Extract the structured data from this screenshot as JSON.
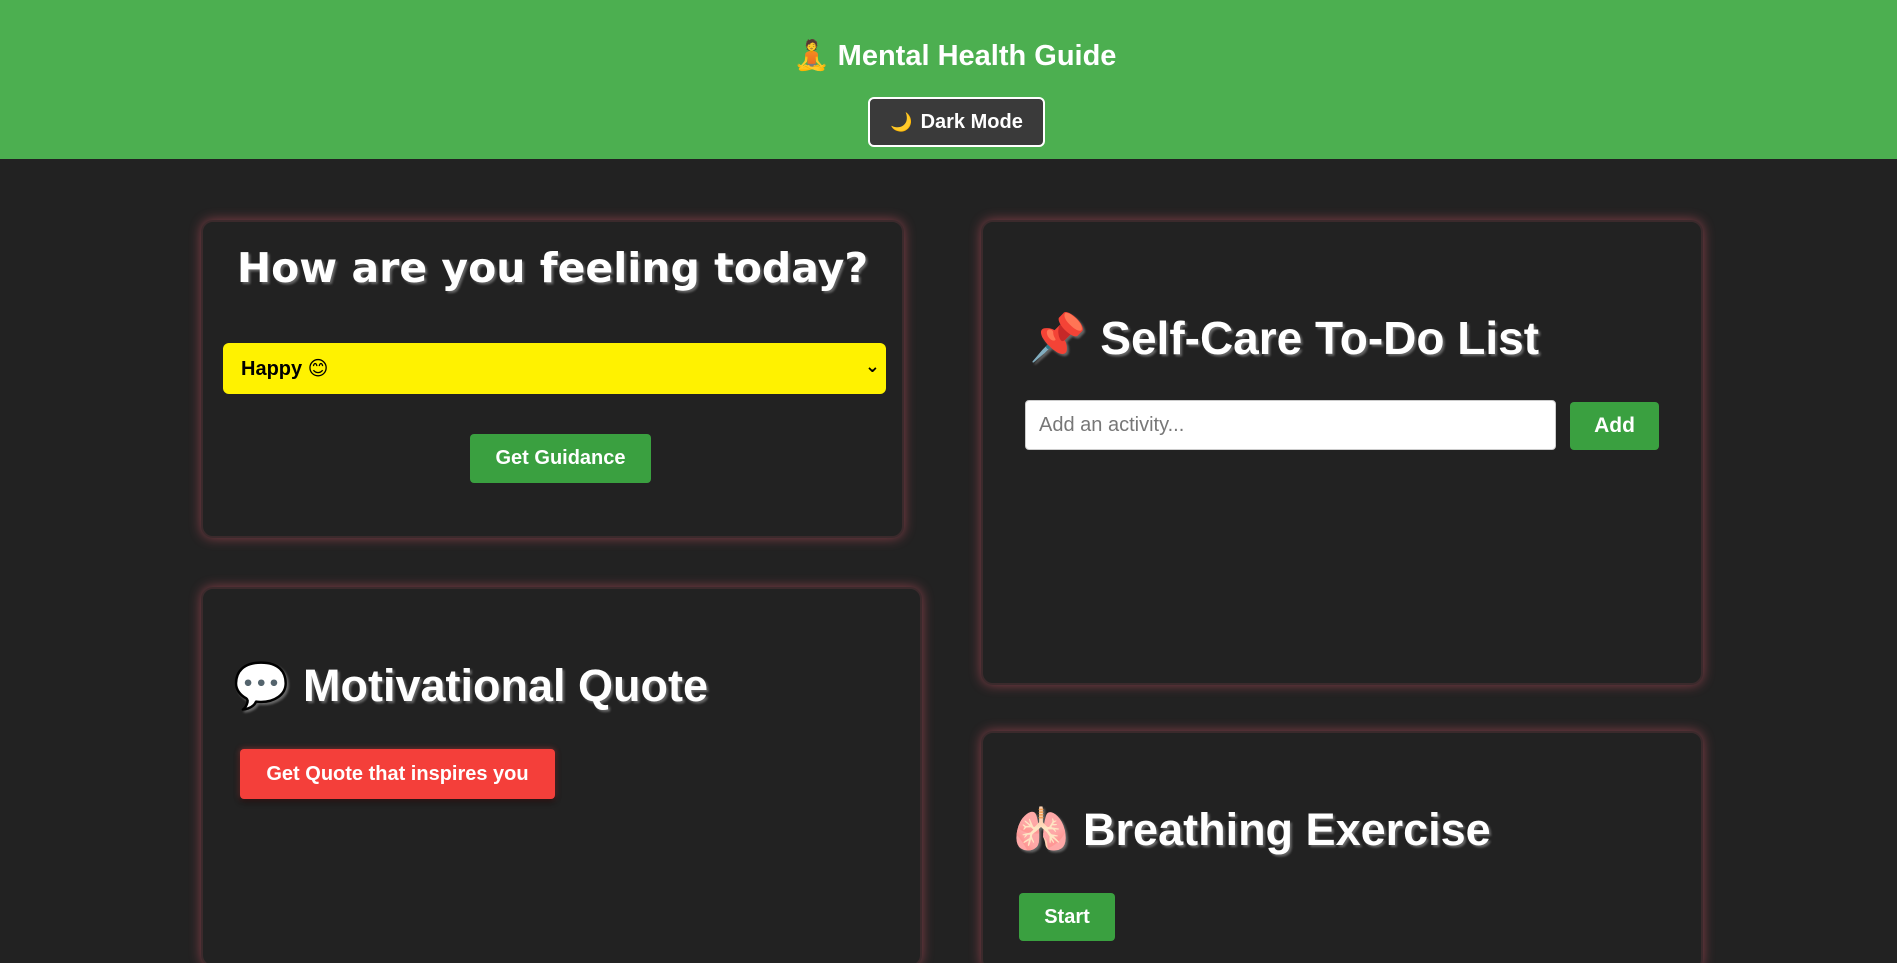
{
  "header": {
    "title": "Mental Health Guide",
    "title_icon": "meditation-icon",
    "dark_mode_label": "Dark Mode",
    "dark_mode_icon": "moon-icon"
  },
  "mood_card": {
    "heading": "How are you feeling today?",
    "selected_mood": "Happy 😊",
    "guidance_button": "Get Guidance"
  },
  "todo_card": {
    "icon": "pushpin-icon",
    "heading": "Self-Care To-Do List",
    "input_placeholder": "Add an activity...",
    "add_button": "Add"
  },
  "quote_card": {
    "icon": "speech-bubble-icon",
    "heading": "Motivational Quote",
    "quote_button": "Get Quote that inspires you"
  },
  "breathing_card": {
    "icon": "lungs-icon",
    "heading": "Breathing Exercise",
    "start_button": "Start"
  },
  "colors": {
    "header_bg": "#4caf50",
    "page_bg": "#222222",
    "select_bg": "#fff200",
    "green_button": "#3aa040",
    "red_button": "#f43f3a",
    "card_glow": "#ff6378"
  }
}
